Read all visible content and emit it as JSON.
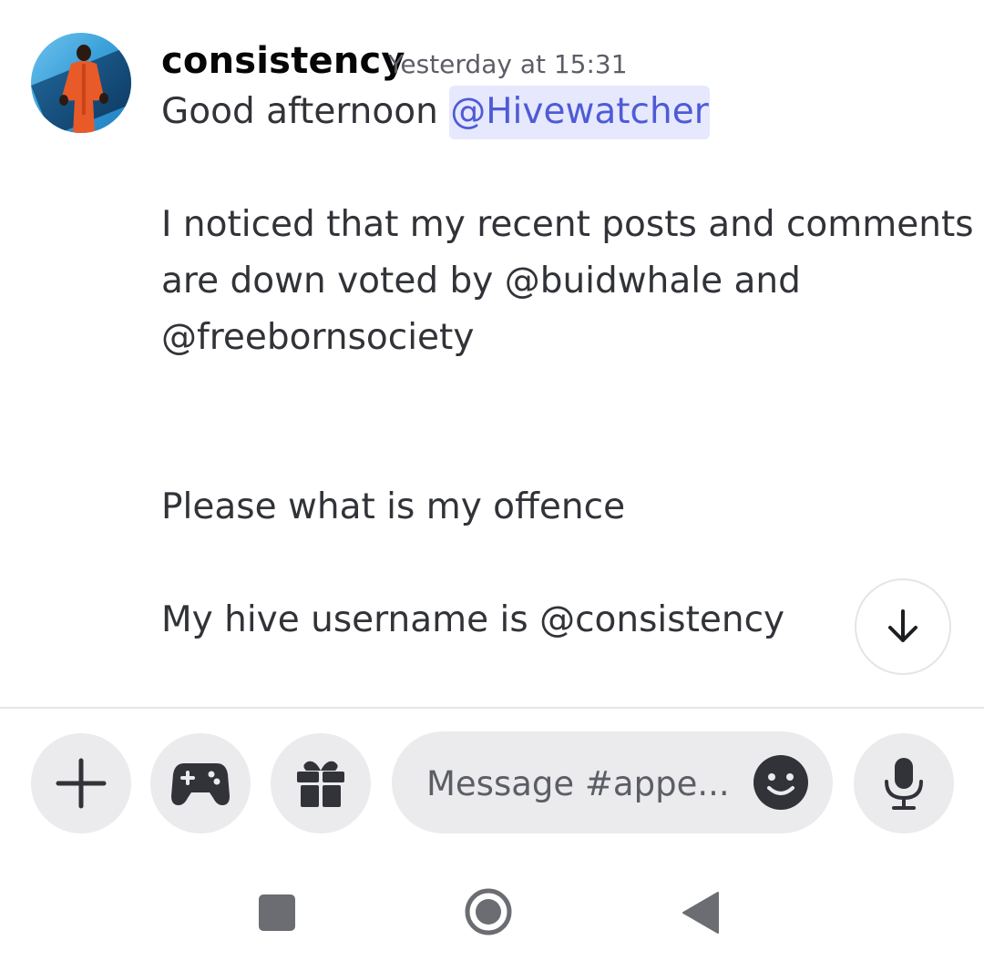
{
  "message": {
    "author": "consistency",
    "timestamp": "Yesterday at 15:31",
    "greeting": "Good afternoon ",
    "mention": "@Hivewatcher",
    "line1": "I noticed that my recent posts and comments",
    "line2": "are down voted by @buidwhale and",
    "line3": "@freebornsociety",
    "line4": "Please what is my offence",
    "line5": "My hive username is @consistency"
  },
  "composer": {
    "placeholder": "Message #appe..."
  },
  "icons": {
    "scroll_down": "arrow-down-icon",
    "add": "plus-icon",
    "activities": "gamepad-icon",
    "gift": "gift-icon",
    "emoji": "smile-icon",
    "voice": "microphone-icon",
    "nav_recents": "square-icon",
    "nav_home": "circle-icon",
    "nav_back": "triangle-back-icon"
  },
  "colors": {
    "mention_bg": "#e6e8fd",
    "mention_text": "#4e5bd6",
    "button_bg": "#ebebed",
    "icon_dark": "#313338"
  }
}
